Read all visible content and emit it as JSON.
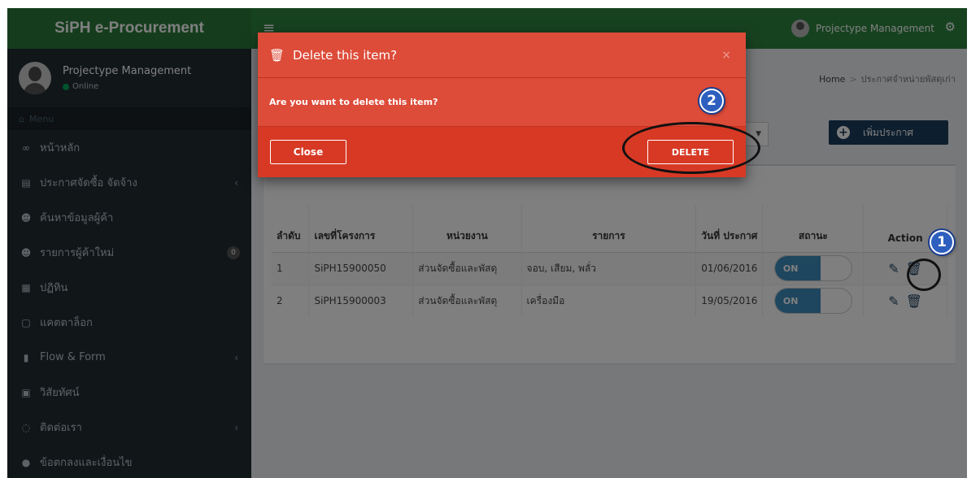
{
  "app": {
    "title": "SiPH e-Procurement"
  },
  "topbar": {
    "user_name": "Projectype Management"
  },
  "sidebar": {
    "user_name": "Projectype Management",
    "status": "Online",
    "menu_header": "Menu",
    "items": [
      {
        "label": "หน้าหลัก",
        "icon": "home-icon"
      },
      {
        "label": "ประกาศจัดซื้อ จัดจ้าง",
        "icon": "newspaper-icon",
        "chevron": true
      },
      {
        "label": "ค้นหาข้อมูลผู้ค้า",
        "icon": "users-icon"
      },
      {
        "label": "รายการผู้ค้าใหม่",
        "icon": "users-icon",
        "badge": "0"
      },
      {
        "label": "ปฏิทิน",
        "icon": "calendar-icon"
      },
      {
        "label": "แคตตาล็อก",
        "icon": "catalog-icon"
      },
      {
        "label": "Flow & Form",
        "icon": "copy-icon",
        "chevron": true
      },
      {
        "label": "วิสัยทัศน์",
        "icon": "image-icon"
      },
      {
        "label": "ติดต่อเรา",
        "icon": "whatsapp-icon",
        "chevron": true
      },
      {
        "label": "ข้อตกลงและเงื่อนไข",
        "icon": "info-icon"
      }
    ]
  },
  "breadcrumb": {
    "home": "Home",
    "current": "ประกาศจำหน่ายพัสดุเก่า"
  },
  "toolbar": {
    "add_label": "เพิ่มประกาศ"
  },
  "table": {
    "headers": [
      "ลำดับ",
      "เลขที่โครงการ",
      "หน่วยงาน",
      "รายการ",
      "วันที่ ประกาศ",
      "สถานะ",
      "Action"
    ],
    "rows": [
      {
        "no": "1",
        "project": "SiPH15900050",
        "dept": "ส่วนจัดซื้อและพัสดุ",
        "item": "จอบ, เสียม, พลั่ว",
        "date": "01/06/2016",
        "status": "ON"
      },
      {
        "no": "2",
        "project": "SiPH15900003",
        "dept": "ส่วนจัดซื้อและพัสดุ",
        "item": "เครื่องมือ",
        "date": "19/05/2016",
        "status": "ON"
      }
    ]
  },
  "modal": {
    "title": "Delete this item?",
    "message": "Are you want to delete this item?",
    "close_label": "Close",
    "delete_label": "DELETE",
    "close_x": "×"
  },
  "callouts": {
    "one": "1",
    "two": "2"
  },
  "colors": {
    "brand_green": "#2e8540",
    "modal_red": "#dd4b39",
    "sidebar_dark": "#222d32",
    "accent_blue": "#3c8dbc"
  }
}
